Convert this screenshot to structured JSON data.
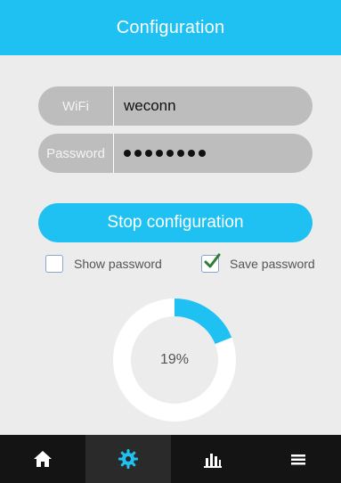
{
  "header": {
    "title": "Configuration"
  },
  "form": {
    "wifi_label": "WiFi",
    "wifi_value": "weconn",
    "password_label": "Password",
    "password_masked_length": 8
  },
  "actions": {
    "stop_label": "Stop configuration"
  },
  "options": {
    "show_password": {
      "label": "Show password",
      "checked": false
    },
    "save_password": {
      "label": "Save password",
      "checked": true
    }
  },
  "progress": {
    "value": 0.19,
    "label": "19%"
  },
  "tabbar": {
    "tabs": [
      {
        "icon": "home-icon",
        "active": false
      },
      {
        "icon": "gear-icon",
        "active": true
      },
      {
        "icon": "chart-icon",
        "active": false
      },
      {
        "icon": "menu-icon",
        "active": false
      }
    ]
  },
  "colors": {
    "accent": "#1ec1f2",
    "field_bg": "#bdbdbd",
    "tabbar_bg": "#141414",
    "progress_track": "#ffffff"
  }
}
